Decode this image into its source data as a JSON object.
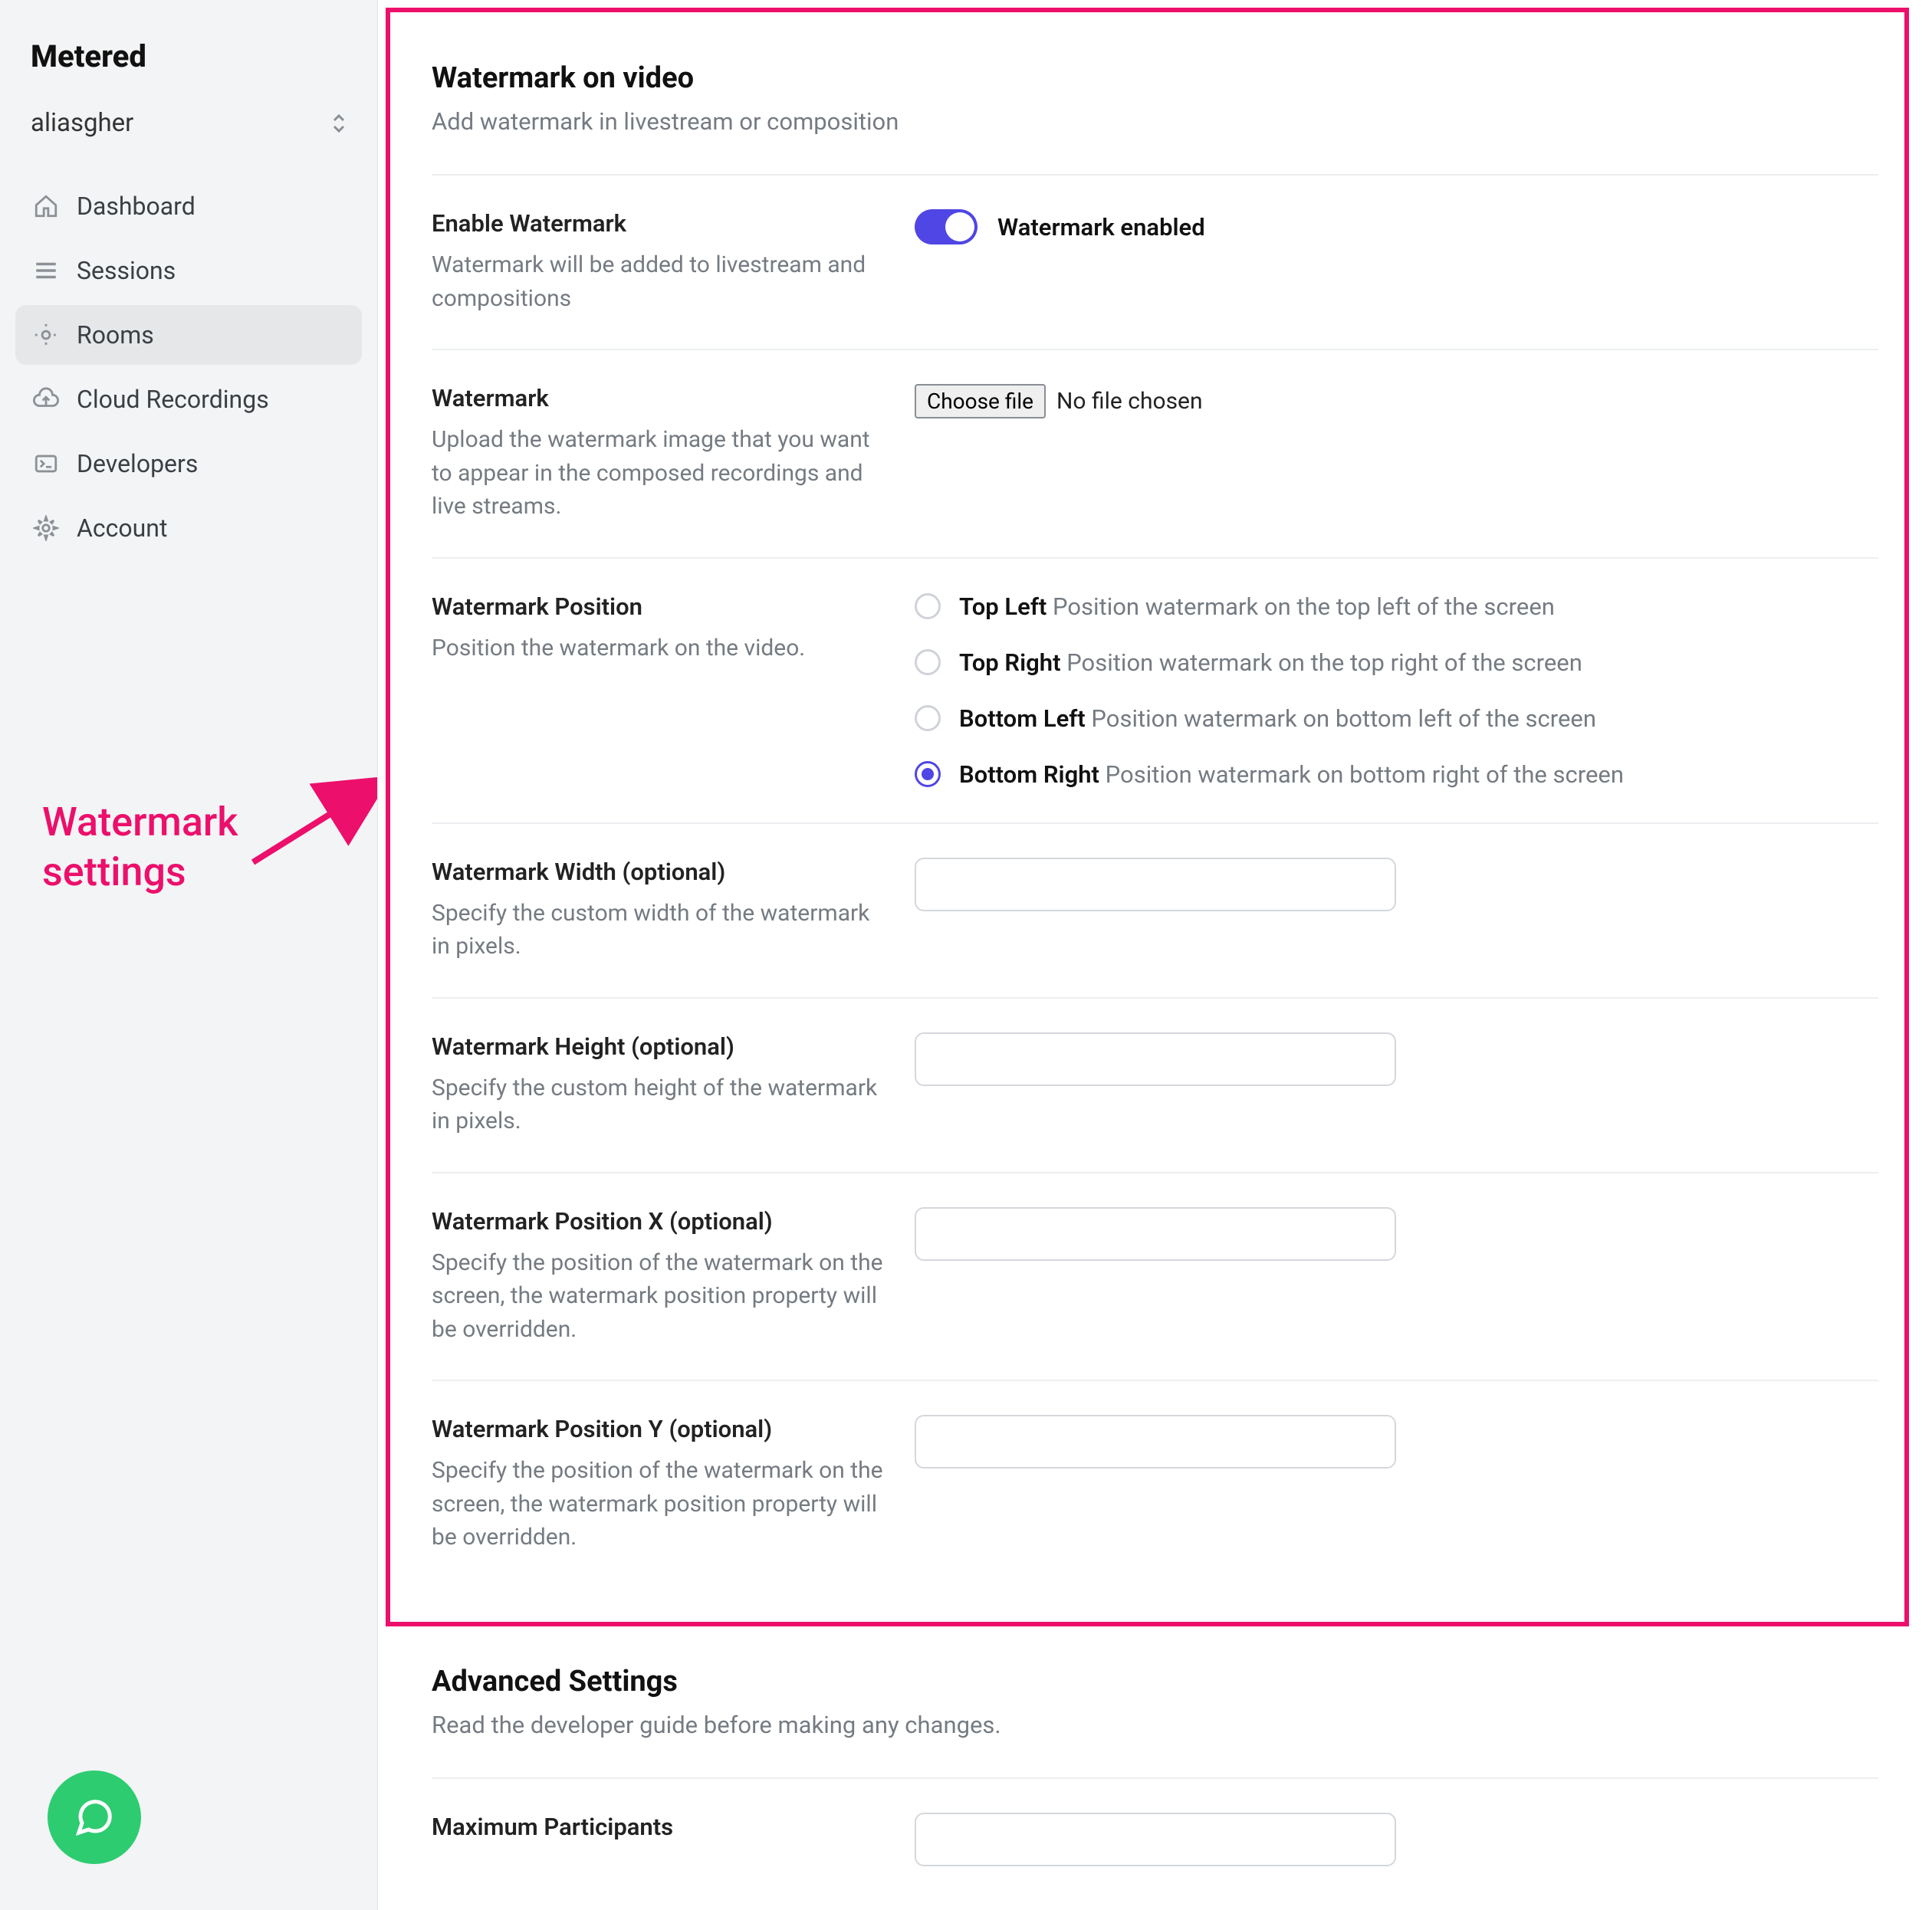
{
  "brand": "Metered",
  "workspace": "aliasgher",
  "nav": {
    "dashboard": "Dashboard",
    "sessions": "Sessions",
    "rooms": "Rooms",
    "cloud_recordings": "Cloud Recordings",
    "developers": "Developers",
    "account": "Account"
  },
  "annotation": "Watermark settings",
  "section": {
    "title": "Watermark on video",
    "subtitle": "Add watermark in livestream or composition"
  },
  "enable": {
    "label": "Enable Watermark",
    "desc": "Watermark will be added to livestream and compositions",
    "toggle_label": "Watermark enabled",
    "toggle_on": true
  },
  "upload": {
    "label": "Watermark",
    "desc": "Upload the watermark image that you want to appear in the composed recordings and live streams.",
    "button": "Choose file",
    "status": "No file chosen"
  },
  "position": {
    "label": "Watermark Position",
    "desc": "Position the watermark on the video.",
    "options": [
      {
        "title": "Top Left",
        "desc": "Position watermark on the top left of the screen",
        "checked": false
      },
      {
        "title": "Top Right",
        "desc": "Position watermark on the top right of the screen",
        "checked": false
      },
      {
        "title": "Bottom Left",
        "desc": "Position watermark on bottom left of the screen",
        "checked": false
      },
      {
        "title": "Bottom Right",
        "desc": "Position watermark on bottom right of the screen",
        "checked": true
      }
    ]
  },
  "width": {
    "label": "Watermark Width (optional)",
    "desc": "Specify the custom width of the watermark in pixels."
  },
  "height": {
    "label": "Watermark Height (optional)",
    "desc": "Specify the custom height of the watermark in pixels."
  },
  "posx": {
    "label": "Watermark Position X (optional)",
    "desc": "Specify the position of the watermark on the screen, the watermark position property will be overridden."
  },
  "posy": {
    "label": "Watermark Position Y (optional)",
    "desc": "Specify the position of the watermark on the screen, the watermark position property will be overridden."
  },
  "advanced": {
    "title": "Advanced Settings",
    "subtitle": "Read the developer guide before making any changes.",
    "max_participants_label": "Maximum Participants"
  }
}
